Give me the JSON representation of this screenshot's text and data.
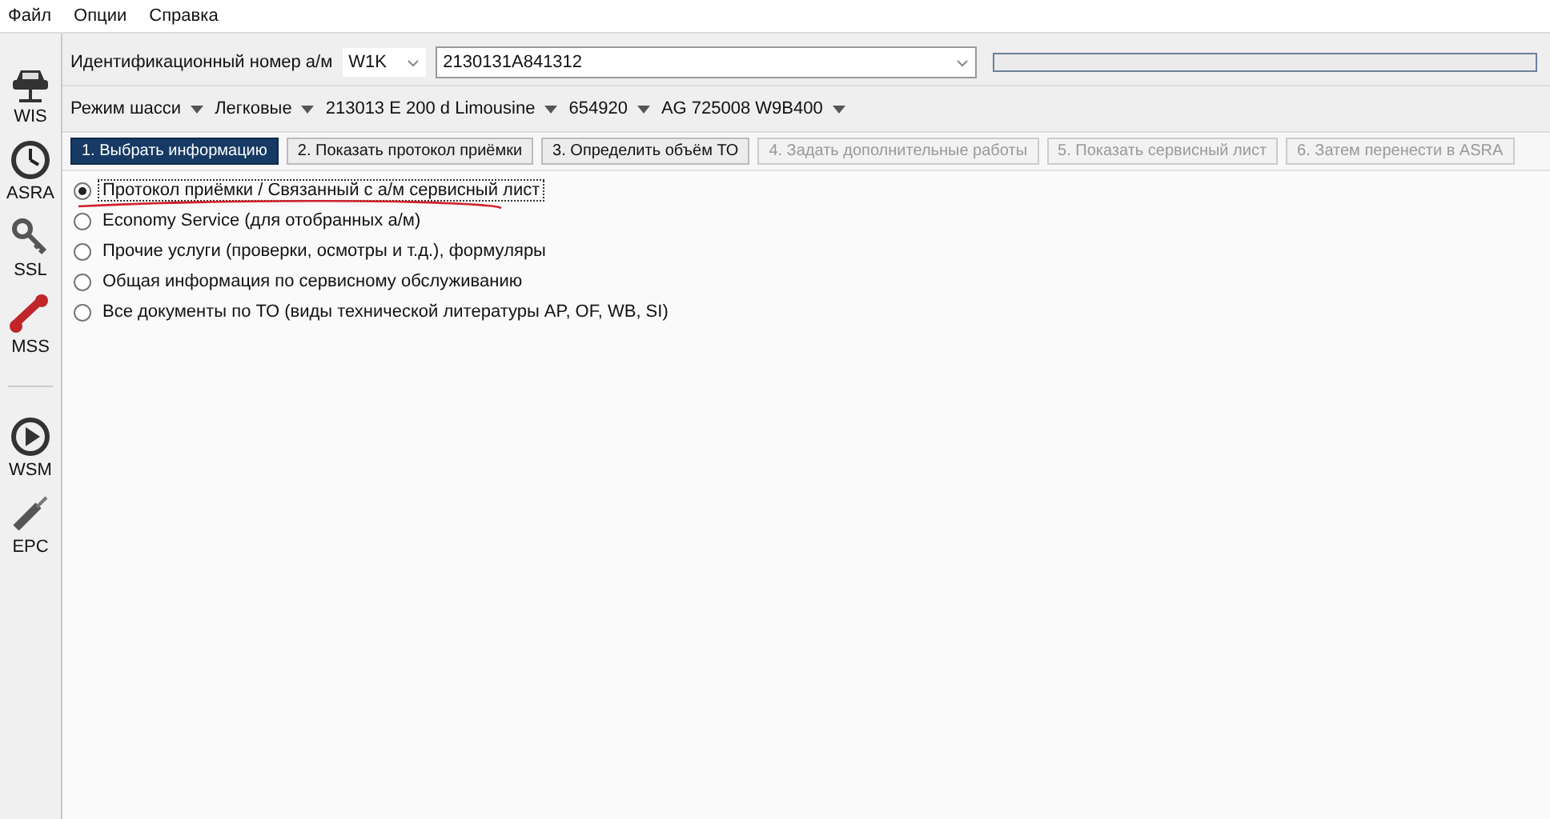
{
  "menu": [
    "Файл",
    "Опции",
    "Справка"
  ],
  "sidebar": {
    "groups": [
      [
        {
          "label": "WIS"
        },
        {
          "label": "ASRA"
        },
        {
          "label": "SSL"
        },
        {
          "label": "MSS"
        }
      ],
      [
        {
          "label": "WSM"
        },
        {
          "label": "EPC"
        }
      ]
    ]
  },
  "progress": {
    "level": 0
  },
  "vin": {
    "label": "Идентификационный номер а/м",
    "prefix": "W1K",
    "value": "2130131A841312"
  },
  "chassis": [
    "Режим шасси",
    "Легковые",
    "213013 E 200 d Limousine",
    "654920",
    "AG 725008 W9B400"
  ],
  "steps": [
    {
      "label": "1. Выбрать информацию",
      "selected": true,
      "disabled": false
    },
    {
      "label": "2. Показать протокол приёмки",
      "selected": false,
      "disabled": false
    },
    {
      "label": "3. Определить объём ТО",
      "selected": false,
      "disabled": false
    },
    {
      "label": "4. Задать дополнительные работы",
      "selected": false,
      "disabled": true
    },
    {
      "label": "5. Показать сервисный лист",
      "selected": false,
      "disabled": true
    },
    {
      "label": "6. Затем перенести в ASRA",
      "selected": false,
      "disabled": true
    }
  ],
  "options": [
    {
      "label": "Протокол приёмки / Связанный с а/м сервисный лист",
      "selected": true
    },
    {
      "label": "Economy Service (для отобранных а/м)",
      "selected": false
    },
    {
      "label": "Прочие услуги (проверки, осмотры и т.д.), формуляры",
      "selected": false
    },
    {
      "label": "Общая информация по сервисному обслуживанию",
      "selected": false
    },
    {
      "label": "Все документы по ТО (виды технической литературы AP, OF, WB, SI)",
      "selected": false
    }
  ]
}
